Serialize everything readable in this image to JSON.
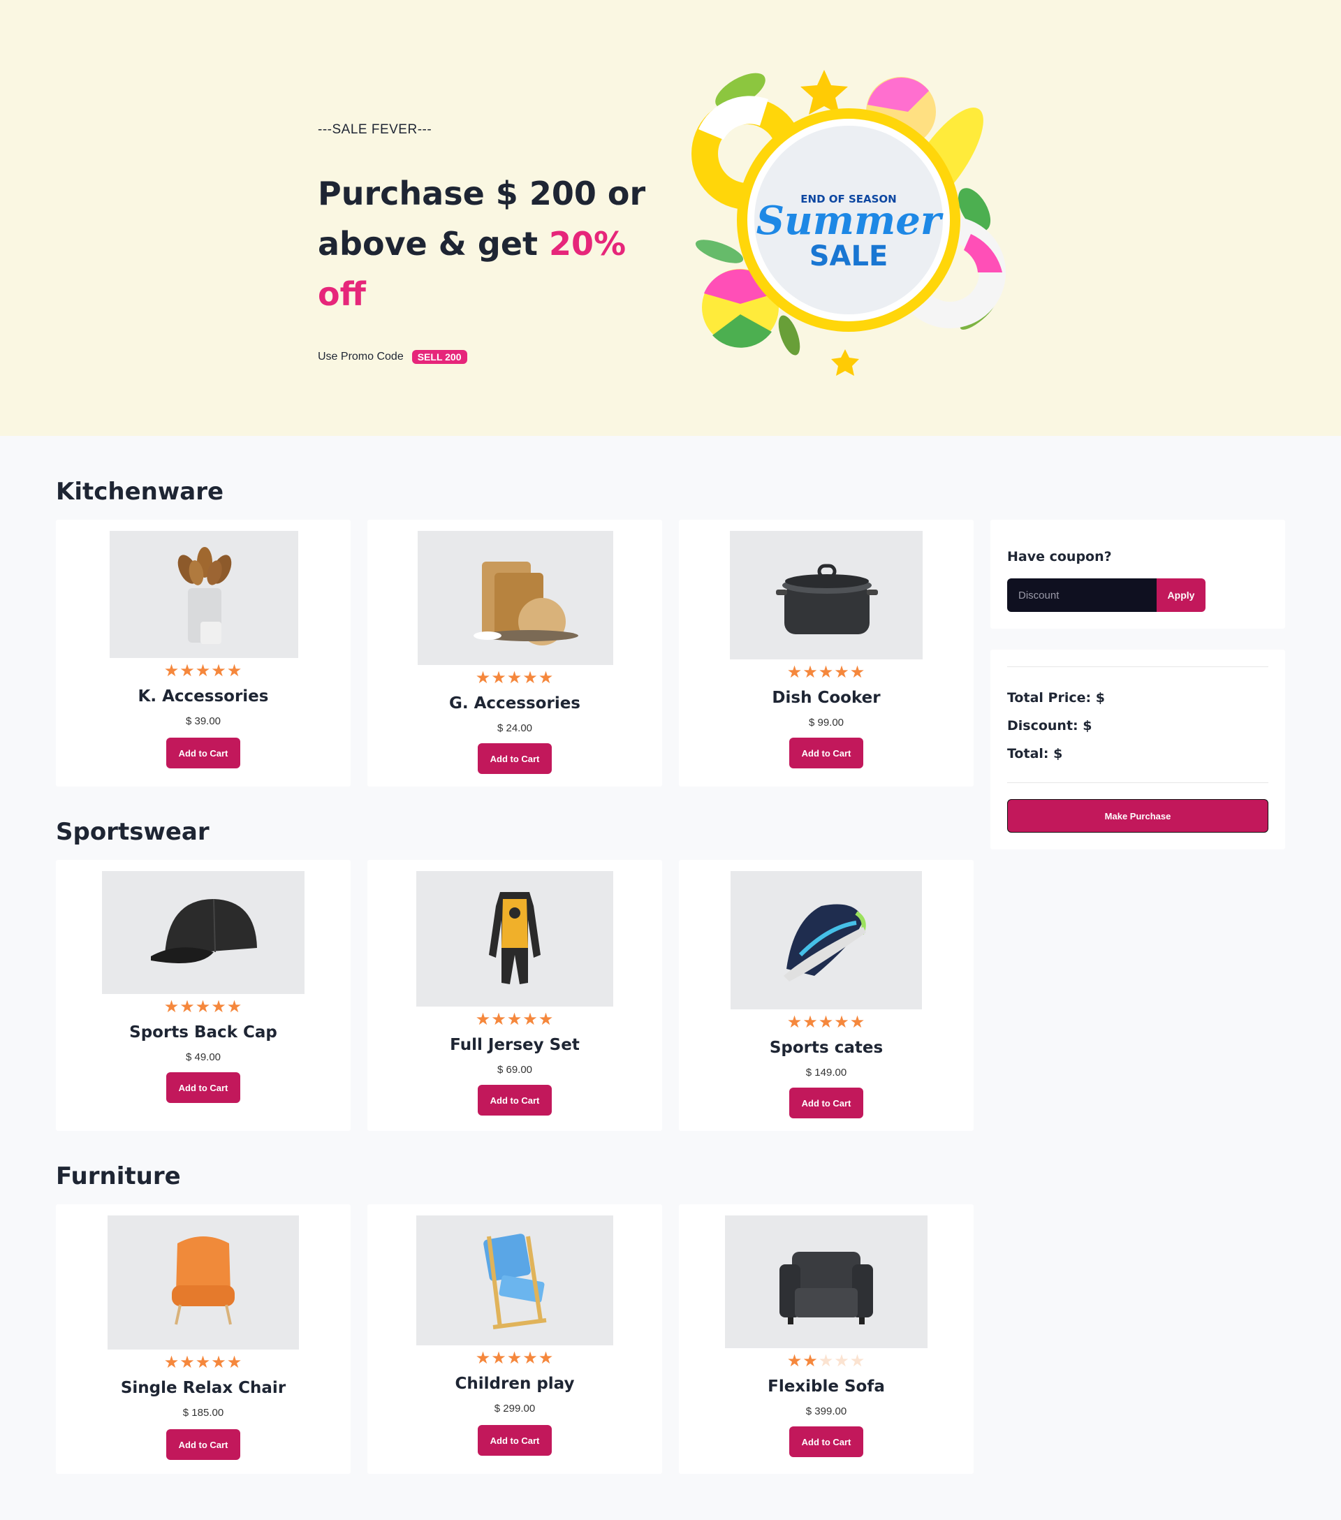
{
  "hero": {
    "eyebrow": "---SALE FEVER---",
    "headline_line1": "Purchase $ 200 or",
    "headline_line2_prefix": "above & get ",
    "headline_accent": "20% off",
    "promo_label": "Use Promo Code",
    "promo_code": "SELL 200",
    "art": {
      "top": "END OF SEASON",
      "script": "Summer",
      "bottom": "SALE"
    }
  },
  "sections": [
    {
      "title": "Kitchenware",
      "products": [
        {
          "name": "K. Accessories",
          "price": "$ 39.00",
          "rating": 5,
          "button": "Add to Cart",
          "image": "kitchen-utensils-image"
        },
        {
          "name": "G. Accessories",
          "price": "$ 24.00",
          "rating": 5,
          "button": "Add to Cart",
          "image": "cutting-boards-image"
        },
        {
          "name": "Dish Cooker",
          "price": "$ 99.00",
          "rating": 5,
          "button": "Add to Cart",
          "image": "cooking-pot-image"
        }
      ]
    },
    {
      "title": "Sportswear",
      "products": [
        {
          "name": "Sports Back Cap",
          "price": "$ 49.00",
          "rating": 5,
          "button": "Add to Cart",
          "image": "cap-image"
        },
        {
          "name": "Full Jersey Set",
          "price": "$ 69.00",
          "rating": 5,
          "button": "Add to Cart",
          "image": "jersey-image"
        },
        {
          "name": "Sports cates",
          "price": "$ 149.00",
          "rating": 5,
          "button": "Add to Cart",
          "image": "sneaker-image"
        }
      ]
    },
    {
      "title": "Furniture",
      "products": [
        {
          "name": "Single Relax Chair",
          "price": "$ 185.00",
          "rating": 5,
          "button": "Add to Cart",
          "image": "armchair-image"
        },
        {
          "name": "Children play",
          "price": "$ 299.00",
          "rating": 5,
          "button": "Add to Cart",
          "image": "folding-chair-image"
        },
        {
          "name": "Flexible Sofa",
          "price": "$ 399.00",
          "rating": 2,
          "button": "Add to Cart",
          "image": "sofa-image"
        }
      ]
    }
  ],
  "coupon": {
    "title": "Have coupon?",
    "placeholder": "Discount",
    "apply_label": "Apply"
  },
  "summary": {
    "total_price": "Total Price: $",
    "discount": "Discount: $",
    "total": "Total: $",
    "purchase_label": "Make Purchase"
  },
  "colors": {
    "accent": "#e6267a",
    "button": "#c2185b",
    "star": "#f5873c",
    "hero_bg": "#faf7e2"
  }
}
